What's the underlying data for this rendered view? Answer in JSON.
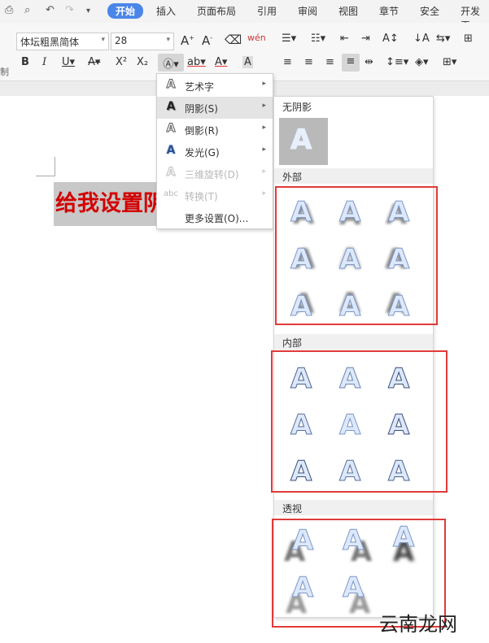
{
  "menu_tabs": [
    "开始",
    "插入",
    "页面布局",
    "引用",
    "审阅",
    "视图",
    "章节",
    "安全",
    "开发工"
  ],
  "toolbar": {
    "font_name": "体坛粗黑简体",
    "font_size": "28",
    "side_label": "制"
  },
  "document": {
    "text": "给我设置阴影"
  },
  "text_effect_menu": [
    {
      "icon": "text-outline-icon",
      "label": "艺术字",
      "has_submenu": true,
      "disabled": false,
      "highlighted": false
    },
    {
      "icon": "shadow-icon",
      "label": "阴影(S)",
      "has_submenu": true,
      "disabled": false,
      "highlighted": true
    },
    {
      "icon": "reflection-icon",
      "label": "倒影(R)",
      "has_submenu": true,
      "disabled": false,
      "highlighted": false
    },
    {
      "icon": "glow-icon",
      "label": "发光(G)",
      "has_submenu": true,
      "disabled": false,
      "highlighted": false
    },
    {
      "icon": "3d-rotation-icon",
      "label": "三维旋转(D)",
      "has_submenu": true,
      "disabled": true,
      "highlighted": false
    },
    {
      "icon": "transform-icon",
      "label": "转换(T)",
      "has_submenu": true,
      "disabled": true,
      "highlighted": false
    },
    {
      "icon": "",
      "label": "更多设置(O)...",
      "has_submenu": false,
      "disabled": false,
      "highlighted": false
    }
  ],
  "shadow_panel": {
    "no_shadow_label": "无阴影",
    "sample_letter": "A",
    "outer_label": "外部",
    "inner_label": "内部",
    "perspective_label": "透视"
  },
  "watermark": "云南龙网",
  "colors": {
    "accent": "#4a86e8",
    "highlight_red": "#e03a3a",
    "doc_text": "#d20000"
  }
}
